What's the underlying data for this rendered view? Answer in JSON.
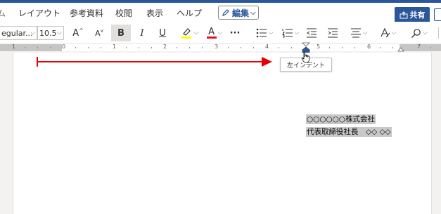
{
  "menu": {
    "items": [
      "レイアウト",
      "参考資料",
      "校閲",
      "表示",
      "ヘルプ"
    ],
    "edit_label": "編集",
    "share_label": "共有"
  },
  "ribbon": {
    "font_name": "egular...",
    "font_size": "10.5",
    "grow_font": "A",
    "shrink_font": "A",
    "bold": "B",
    "italic": "I",
    "underline": "U",
    "highlight_color": "#ffff00",
    "font_color": "#e81123",
    "more": "···"
  },
  "ruler": {
    "numbers": [
      "1",
      "0",
      "1",
      "2",
      "3",
      "4",
      "5",
      "6",
      "7"
    ]
  },
  "tooltip": {
    "text": "左インデント"
  },
  "document": {
    "line1": "○○○○○○株式会社",
    "line2": "代表取締役社長　◇◇ ◇◇"
  },
  "annotation": {
    "arrow_color": "#e60000"
  }
}
